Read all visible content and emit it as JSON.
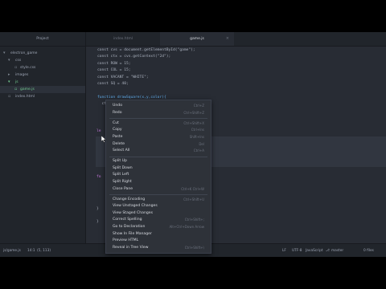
{
  "tree": {
    "header": "Project",
    "items": [
      {
        "label": "electron_game",
        "icon": "folder-open-icon",
        "depth": 0
      },
      {
        "label": "css",
        "icon": "folder-icon",
        "depth": 1
      },
      {
        "label": "style.css",
        "icon": "file-icon",
        "depth": 2
      },
      {
        "label": "images",
        "icon": "folder-icon",
        "depth": 1
      },
      {
        "label": "js",
        "icon": "folder-open-icon",
        "depth": 1
      },
      {
        "label": "game.js",
        "icon": "file-icon",
        "depth": 2
      },
      {
        "label": "index.html",
        "icon": "file-icon",
        "depth": 1
      }
    ]
  },
  "tabs": [
    {
      "label": "index.html",
      "active": false
    },
    {
      "label": "game.js",
      "active": true
    }
  ],
  "code": {
    "line1": "const cvs = document.getElementById(\"game\");",
    "line2": "const ctx = cvs.getContext(\"2d\");",
    "line3": "const ROW = 15;",
    "line4": "const COL = 15;",
    "line5": "const VACANT = \"WHITE\";",
    "line6": "const SQ = 40;",
    "line7": "function drawSquare(x,y,color){",
    "line8": "  ctx.fillStyle = color;",
    "frag1": "le",
    "frag2": "fo",
    "frag3": "}",
    "frag4": "}"
  },
  "menu": {
    "items": [
      {
        "label": "Undo",
        "shortcut": "Ctrl+Z"
      },
      {
        "label": "Redo",
        "shortcut": "Ctrl+Shift+Z"
      },
      {
        "label": "Cut",
        "shortcut": "Ctrl+Shift+X"
      },
      {
        "label": "Copy",
        "shortcut": "Ctrl+Ins"
      },
      {
        "label": "Paste",
        "shortcut": "Shift+Ins"
      },
      {
        "label": "Delete",
        "shortcut": "Del"
      },
      {
        "label": "Select All",
        "shortcut": "Ctrl+A"
      },
      {
        "label": "Split Up",
        "shortcut": ""
      },
      {
        "label": "Split Down",
        "shortcut": ""
      },
      {
        "label": "Split Left",
        "shortcut": ""
      },
      {
        "label": "Split Right",
        "shortcut": ""
      },
      {
        "label": "Close Pane",
        "shortcut": "Ctrl+K Ctrl+W"
      },
      {
        "label": "Change Encoding",
        "shortcut": "Ctrl+Shift+U"
      },
      {
        "label": "View Unstaged Changes",
        "shortcut": ""
      },
      {
        "label": "View Staged Changes",
        "shortcut": ""
      },
      {
        "label": "Correct Spelling",
        "shortcut": "Ctrl+Shift+;"
      },
      {
        "label": "Go to Declaration",
        "shortcut": "Alt+Ctrl+Down Arrow"
      },
      {
        "label": "Show In File Manager",
        "shortcut": ""
      },
      {
        "label": "Preview HTML",
        "shortcut": ""
      },
      {
        "label": "Reveal in Tree View",
        "shortcut": "Ctrl+Shift+\\"
      }
    ]
  },
  "status": {
    "file": "js/game.js",
    "position": "14:1",
    "selection": "(5, 113)",
    "line_ending": "LF",
    "encoding": "UTF-8",
    "grammar": "JavaScript",
    "branch": "master",
    "sync": "0 files"
  },
  "colors": {
    "background": "#282c34",
    "panel": "#21252b",
    "menu": "#2e3239",
    "accent_green": "#73c990"
  }
}
